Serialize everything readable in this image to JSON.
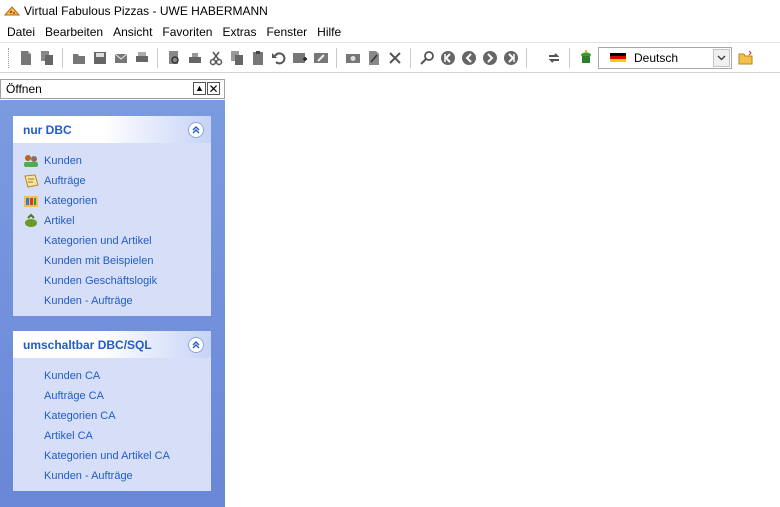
{
  "window": {
    "title": "Virtual Fabulous Pizzas - UWE HABERMANN",
    "icon": "pizza-icon"
  },
  "menu": [
    "Datei",
    "Bearbeiten",
    "Ansicht",
    "Favoriten",
    "Extras",
    "Fenster",
    "Hilfe"
  ],
  "toolbar": {
    "icons": [
      "new-document-icon",
      "copy-document-icon",
      "open-icon",
      "save-icon",
      "email-icon",
      "print-icon",
      "print-preview-icon",
      "print-setup-icon",
      "cut-icon",
      "copy-icon",
      "paste-icon",
      "undo-icon",
      "new-record-icon",
      "edit-record-icon",
      "screenshot-icon",
      "edit-icon",
      "delete-icon",
      "search-icon",
      "first-record-icon",
      "previous-record-icon",
      "next-record-icon",
      "last-record-icon",
      "refresh-icon",
      "stack-icon",
      "folder-open-icon"
    ],
    "language": "Deutsch"
  },
  "panel": {
    "title": "Öffnen",
    "groups": [
      {
        "title": "nur DBC",
        "items": [
          {
            "label": "Kunden",
            "icon": "customers-icon"
          },
          {
            "label": "Aufträge",
            "icon": "orders-icon"
          },
          {
            "label": "Kategorien",
            "icon": "categories-icon"
          },
          {
            "label": "Artikel",
            "icon": "articles-icon"
          },
          {
            "label": "Kategorien und Artikel",
            "icon": ""
          },
          {
            "label": "Kunden mit Beispielen",
            "icon": ""
          },
          {
            "label": "Kunden Geschäftslogik",
            "icon": ""
          },
          {
            "label": "Kunden - Aufträge",
            "icon": ""
          }
        ]
      },
      {
        "title": "umschaltbar DBC/SQL",
        "items": [
          {
            "label": "Kunden CA",
            "icon": ""
          },
          {
            "label": "Aufträge CA",
            "icon": ""
          },
          {
            "label": "Kategorien CA",
            "icon": ""
          },
          {
            "label": "Artikel CA",
            "icon": ""
          },
          {
            "label": "Kategorien und Artikel CA",
            "icon": ""
          },
          {
            "label": "Kunden - Aufträge",
            "icon": ""
          }
        ]
      }
    ]
  },
  "colors": {
    "accent": "#215dc6",
    "panel_bg": "#7b9be0",
    "group_bg": "#d6dff7"
  }
}
